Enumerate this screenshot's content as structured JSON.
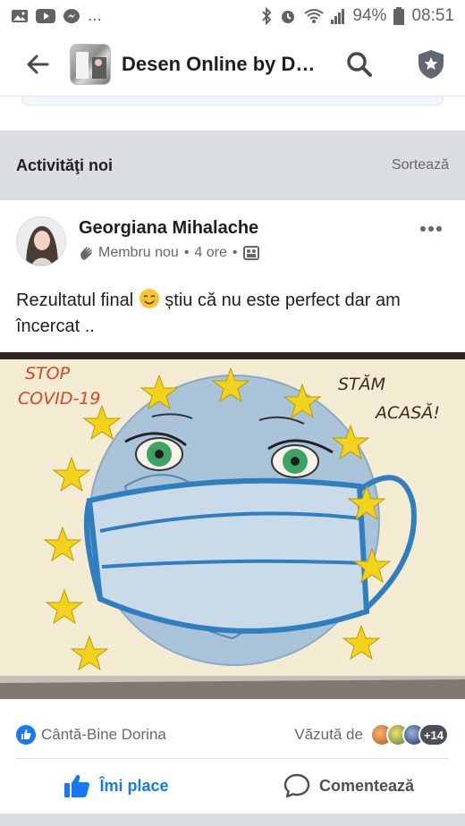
{
  "status_bar": {
    "battery": "94%",
    "time": "08:51",
    "overflow": "..."
  },
  "app_bar": {
    "title": "Desen Online by D…",
    "icons": [
      "back-arrow-icon",
      "search-icon",
      "shield-star-icon"
    ]
  },
  "section": {
    "title": "Activităţi noi",
    "sort_label": "Sortează"
  },
  "post": {
    "author": "Georgiana Mihalache",
    "badge": "Membru nou",
    "time": "4 ore",
    "separator": "•",
    "text_before_emoji": "Rezultatul final",
    "text_after_emoji": " știu că nu este perfect dar am încercat ..",
    "drawing": {
      "caption_left_1": "STOP",
      "caption_left_2": "COVID-19",
      "caption_right_1": "STĂM",
      "caption_right_2": "ACASĂ!"
    },
    "reactions": {
      "liked_by": "Cântă-Bine Dorina",
      "seen_by_label": "Văzută de",
      "seen_extra": "+14"
    },
    "actions": {
      "like_label": "Îmi place",
      "comment_label": "Comentează"
    }
  },
  "colors": {
    "accent": "#1877f2",
    "section_bg": "#dadde1",
    "muted_text": "#65676b"
  }
}
